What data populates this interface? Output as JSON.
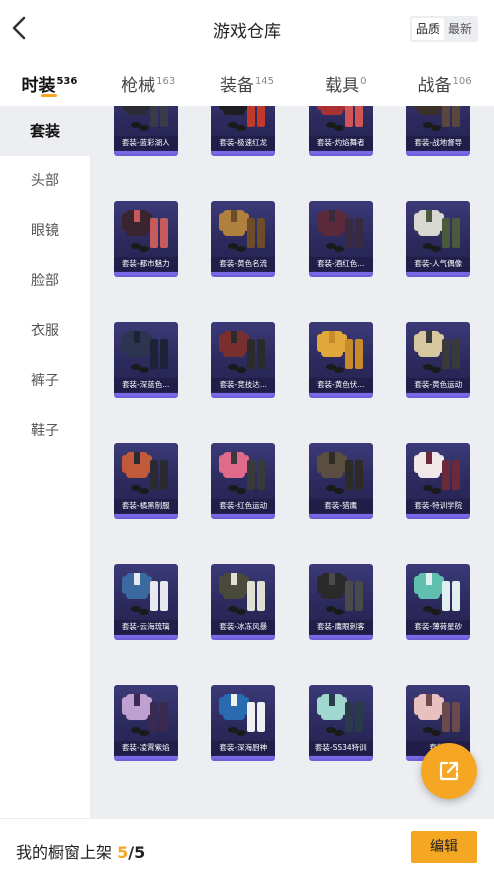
{
  "header": {
    "title": "游戏仓库",
    "sort": [
      "品质",
      "最新"
    ]
  },
  "tabs": [
    {
      "label": "时装",
      "count": "536"
    },
    {
      "label": "枪械",
      "count": "163"
    },
    {
      "label": "装备",
      "count": "145"
    },
    {
      "label": "载具",
      "count": "0"
    },
    {
      "label": "战备",
      "count": "106"
    }
  ],
  "sidebar": [
    "套装",
    "头部",
    "眼镜",
    "脸部",
    "衣服",
    "裤子",
    "鞋子"
  ],
  "items": [
    {
      "label": "套装-蓝彩湖人",
      "icon": "dark-suit-outfit-icon"
    },
    {
      "label": "套装-极速红龙",
      "icon": "racing-suit-outfit-icon"
    },
    {
      "label": "套装-灼焰舞者",
      "icon": "red-dancer-outfit-icon"
    },
    {
      "label": "套装-战地督导",
      "icon": "field-coat-outfit-icon"
    },
    {
      "label": "套装-都市魅力",
      "icon": "city-outfit-icon"
    },
    {
      "label": "套装-黄色名流",
      "icon": "yellow-jacket-outfit-icon"
    },
    {
      "label": "套装-酒红色...",
      "icon": "wine-suit-outfit-icon"
    },
    {
      "label": "套装-人气偶像",
      "icon": "idol-outfit-icon"
    },
    {
      "label": "套装-深蓝色...",
      "icon": "navy-suit-outfit-icon"
    },
    {
      "label": "套装-竞技达...",
      "icon": "sport-outfit-icon"
    },
    {
      "label": "套装-黄色伏...",
      "icon": "yellow-hoodie-outfit-icon"
    },
    {
      "label": "套装-黄色运动",
      "icon": "yellow-sport-outfit-icon"
    },
    {
      "label": "套装-橘黑制服",
      "icon": "orange-uniform-outfit-icon"
    },
    {
      "label": "套装-红色运动",
      "icon": "red-sport-outfit-icon"
    },
    {
      "label": "套装-猎鹰",
      "icon": "falcon-outfit-icon"
    },
    {
      "label": "套装-特训学院",
      "icon": "academy-outfit-icon"
    },
    {
      "label": "套装-云海琉璃",
      "icon": "cloud-dress-outfit-icon"
    },
    {
      "label": "套装-冰冻风暴",
      "icon": "frost-storm-outfit-icon"
    },
    {
      "label": "套装-鹰眼刺客",
      "icon": "assassin-outfit-icon"
    },
    {
      "label": "套装-薄荷星砂",
      "icon": "mint-outfit-icon"
    },
    {
      "label": "套装-凌霄紫焰",
      "icon": "purple-flame-outfit-icon"
    },
    {
      "label": "套装-深海厨神",
      "icon": "chef-outfit-icon"
    },
    {
      "label": "套装-SS34特训",
      "icon": "ss34-outfit-icon"
    },
    {
      "label": "套装-",
      "icon": "outfit-icon"
    }
  ],
  "bottom": {
    "showcase_label": "我的橱窗上架",
    "showcase_current": "5",
    "showcase_sep": "/",
    "showcase_total": "5",
    "edit_label": "编辑"
  },
  "colors": {
    "accent": "#f5a623",
    "card_bg": "#2c2a5c",
    "card_border": "#7a68e6",
    "grid_bg": "#eceef2"
  }
}
